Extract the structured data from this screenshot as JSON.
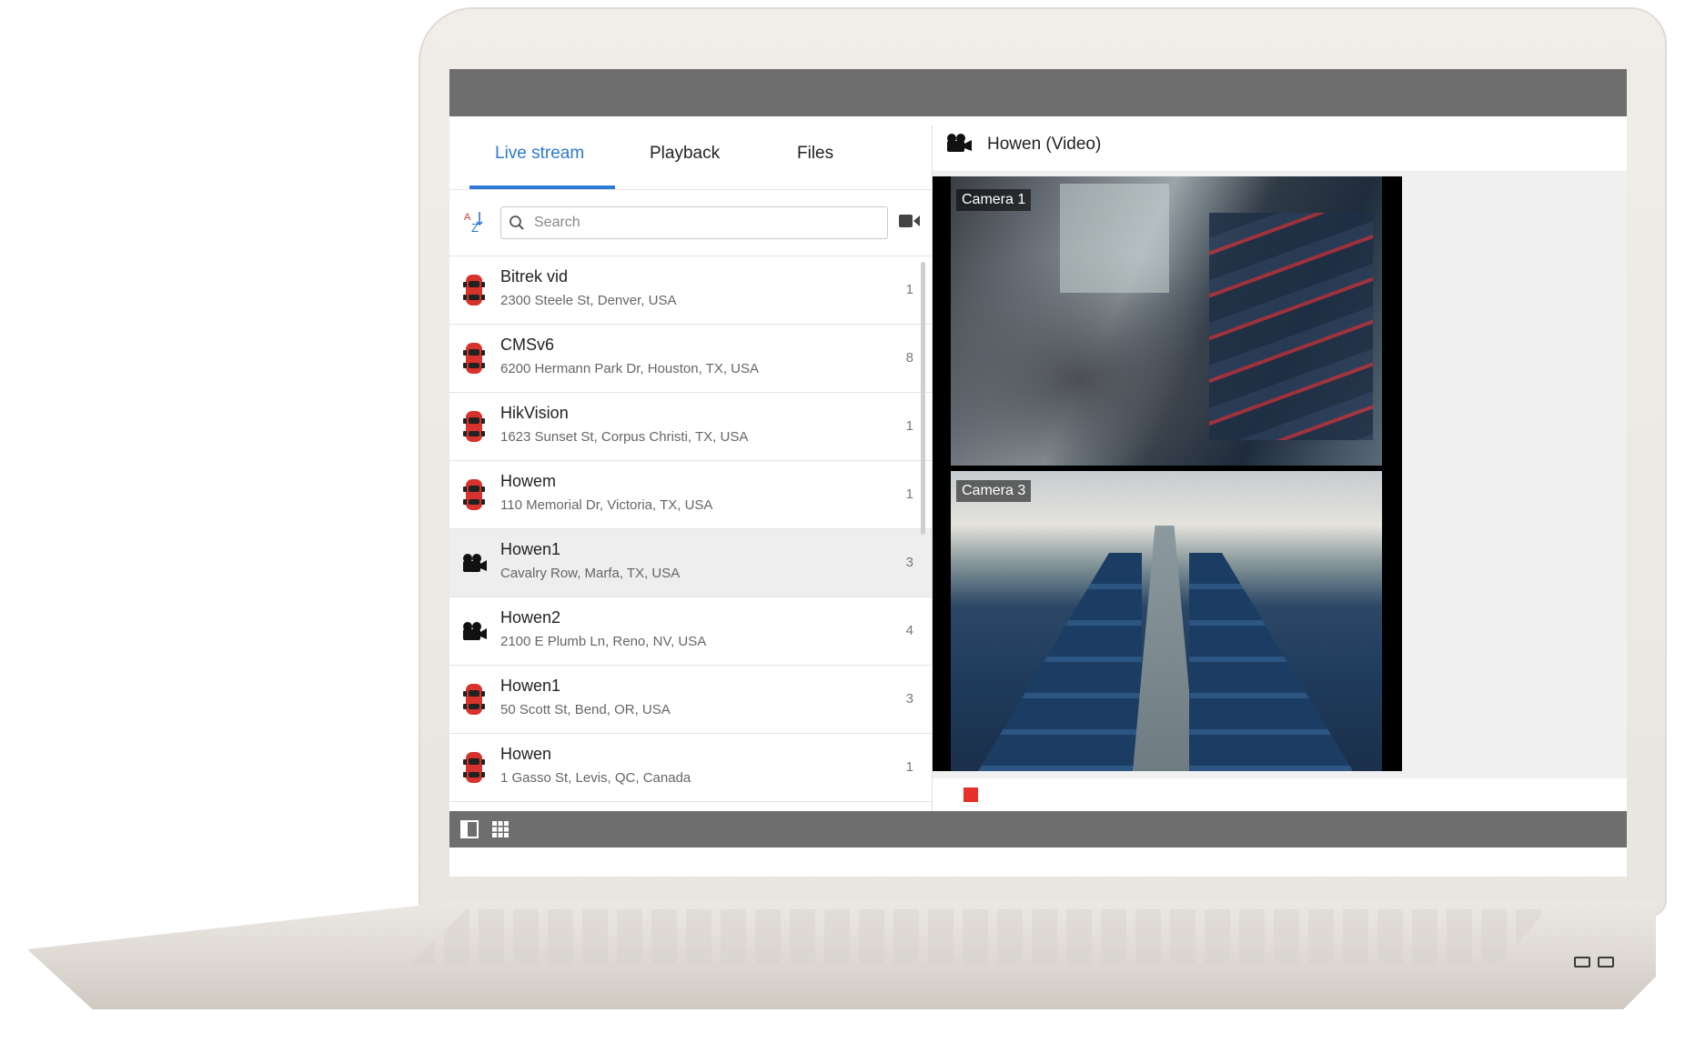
{
  "tabs": [
    {
      "label": "Live stream",
      "active": true
    },
    {
      "label": "Playback",
      "active": false
    },
    {
      "label": "Files",
      "active": false
    }
  ],
  "search": {
    "placeholder": "Search",
    "value": ""
  },
  "units": [
    {
      "name": "Bitrek vid",
      "address": "2300 Steele St, Denver, USA",
      "count": "1",
      "icon": "car-icon",
      "selected": false
    },
    {
      "name": "CMSv6",
      "address": "6200 Hermann Park Dr, Houston, TX, USA",
      "count": "8",
      "icon": "car-icon",
      "selected": false
    },
    {
      "name": "HikVision",
      "address": "1623 Sunset St, Corpus Christi, TX, USA",
      "count": "1",
      "icon": "car-icon",
      "selected": false
    },
    {
      "name": "Howem",
      "address": "110 Memorial Dr, Victoria, TX, USA",
      "count": "1",
      "icon": "car-icon",
      "selected": false
    },
    {
      "name": "Howen1",
      "address": "Cavalry Row, Marfa, TX, USA",
      "count": "3",
      "icon": "video-camera-icon",
      "selected": true
    },
    {
      "name": "Howen2",
      "address": "2100 E Plumb Ln, Reno, NV, USA",
      "count": "4",
      "icon": "video-camera-icon",
      "selected": false
    },
    {
      "name": "Howen1",
      "address": "50 Scott St, Bend, OR, USA",
      "count": "3",
      "icon": "car-icon",
      "selected": false
    },
    {
      "name": "Howen",
      "address": "1 Gasso St, Levis, QC, Canada",
      "count": "1",
      "icon": "car-icon",
      "selected": false
    }
  ],
  "video": {
    "title": "Howen (Video)",
    "feeds": [
      {
        "label": "Camera 1"
      },
      {
        "label": "Camera 3"
      }
    ]
  },
  "colors": {
    "accent": "#2d79d3",
    "bars": "#6e6e6e",
    "car": "#d8322c",
    "stop": "#e8302a"
  }
}
